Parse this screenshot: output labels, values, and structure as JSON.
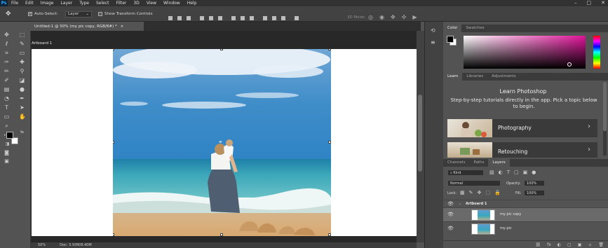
{
  "app": {
    "logo": "Ps"
  },
  "menu": [
    "File",
    "Edit",
    "Image",
    "Layer",
    "Type",
    "Select",
    "Filter",
    "3D",
    "View",
    "Window",
    "Help"
  ],
  "window_controls": [
    "–",
    "□",
    "✕"
  ],
  "options": {
    "auto_select_label": "Auto-Select:",
    "auto_select_value": "Layer",
    "show_transform_label": "Show Transform Controls",
    "mode_3d_label": "3D Mode:"
  },
  "document": {
    "tab_title": "Untitled-1 @ 50% (my pic copy, RGB/8#) *",
    "tab_close": "×",
    "artboard_label": "Artboard 1"
  },
  "status": {
    "zoom": "50%",
    "doc": "Doc: 3.93M/8.40M"
  },
  "color_panel": {
    "tabs": [
      "Color",
      "Swatches"
    ]
  },
  "learn_panel": {
    "tabs": [
      "Learn",
      "Libraries",
      "Adjustments"
    ],
    "title": "Learn Photoshop",
    "desc": "Step-by-step tutorials directly in the app. Pick a topic below to begin.",
    "cards": [
      {
        "label": "Photography"
      },
      {
        "label": "Retouching"
      }
    ]
  },
  "layers_panel": {
    "tabs": [
      "Channels",
      "Paths",
      "Layers"
    ],
    "kind_label": "Kind",
    "blend_mode": "Normal",
    "opacity_label": "Opacity:",
    "opacity_value": "100%",
    "lock_label": "Lock:",
    "fill_label": "Fill:",
    "fill_value": "100%",
    "artboard_group": "Artboard 1",
    "layers": [
      {
        "name": "my pic copy"
      },
      {
        "name": "my pic"
      }
    ],
    "bottom_icons": [
      "fx",
      "◐",
      "▢",
      "▣",
      "＋",
      "🗑"
    ]
  },
  "colors": {
    "accent": "#31a8ff",
    "foreground": "#000000",
    "background": "#ffffff"
  }
}
